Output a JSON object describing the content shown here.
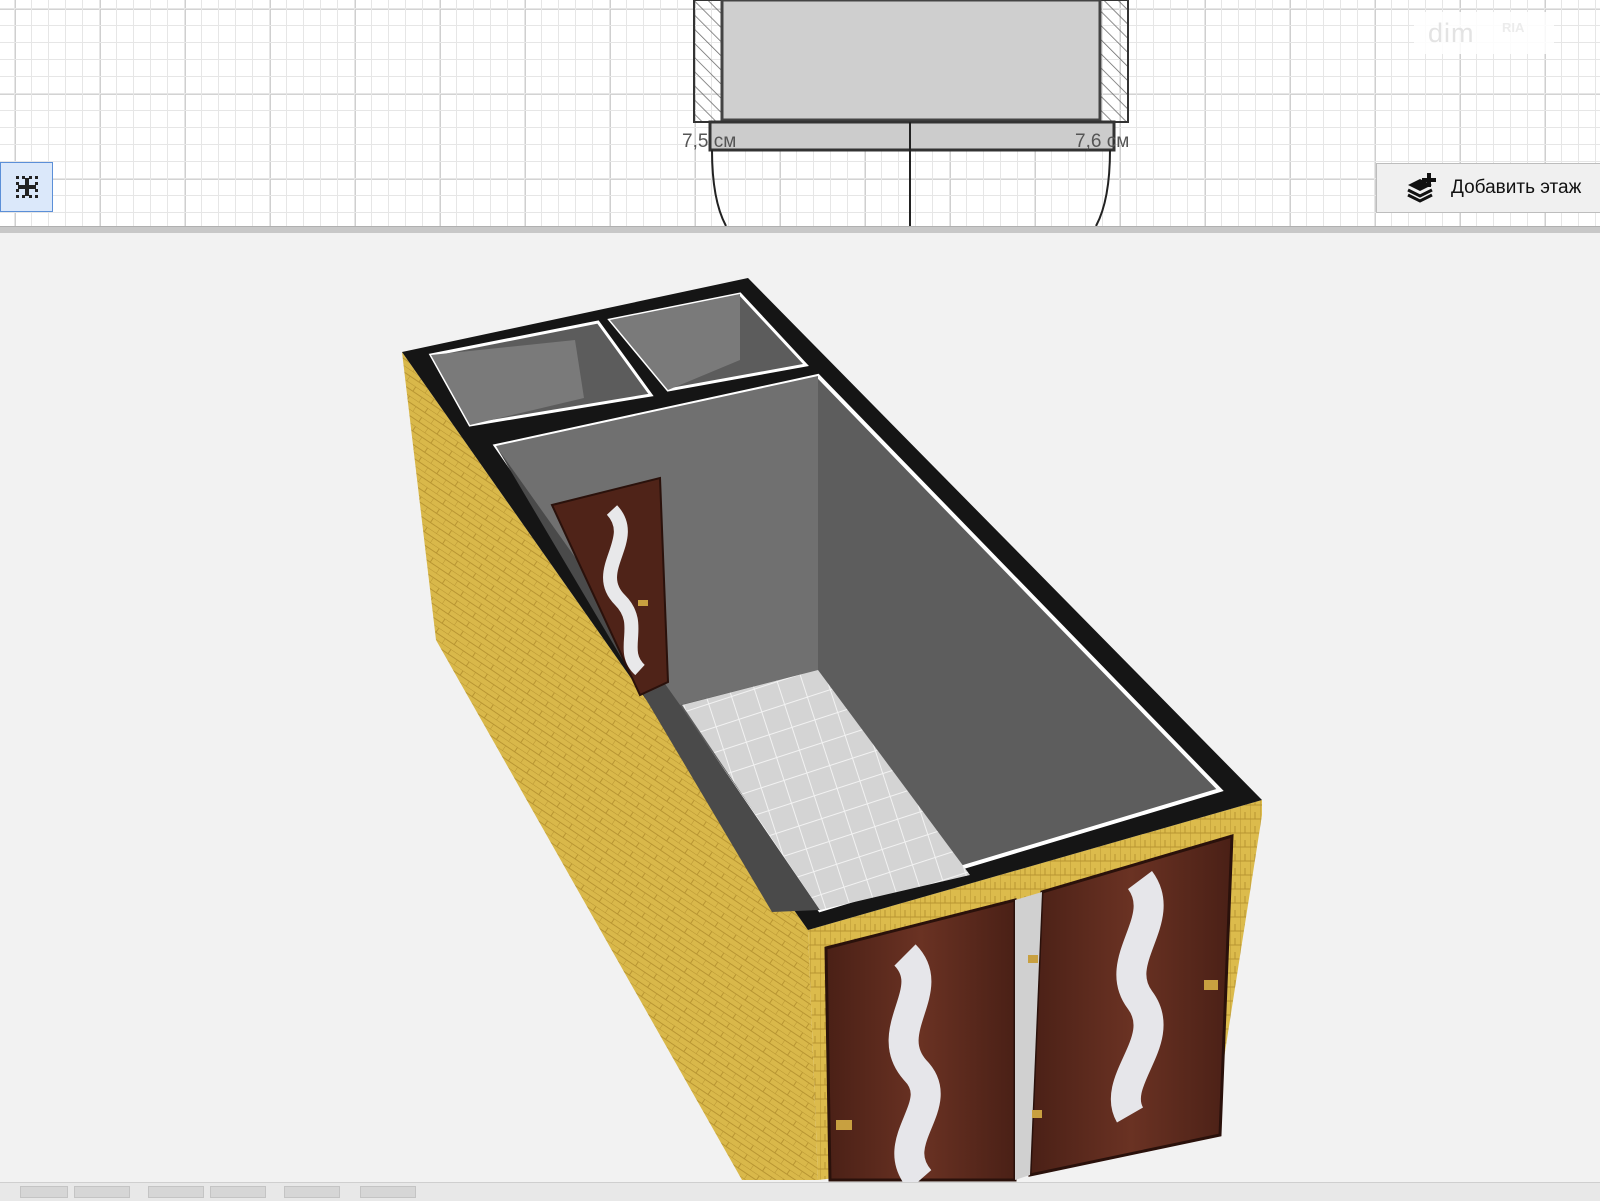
{
  "plan": {
    "dimension_left": "7,5 см",
    "dimension_right": "7,6 см"
  },
  "toolbar": {
    "add_floor_label": "Добавить этаж"
  },
  "watermark": {
    "text": "dim",
    "badge": "RIA"
  },
  "icons": {
    "grid_toggle": "grid-snap-icon",
    "add_floor": "add-layers-icon"
  },
  "colors": {
    "grid_toggle_bg": "#dbe8fa",
    "grid_toggle_border": "#5b8fd8",
    "brick": "#d9b84a",
    "door": "#5b2a1c",
    "interior_wall": "#5a5a5a",
    "floor_tile": "#d4d4d4"
  }
}
